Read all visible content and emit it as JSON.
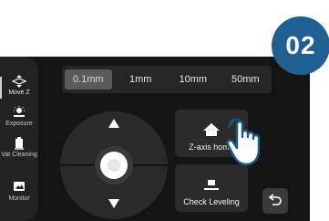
{
  "step_badge": "02",
  "sidebar": {
    "items": [
      {
        "label": "Move Z",
        "icon": "move-z-icon",
        "active": true
      },
      {
        "label": "Exposure",
        "icon": "exposure-icon"
      },
      {
        "label": "Vat Cleaning",
        "icon": "vat-cleaning-icon"
      },
      {
        "label": "Monitor",
        "icon": "monitor-icon"
      }
    ]
  },
  "step_options": {
    "items": [
      "0.1mm",
      "1mm",
      "10mm",
      "50mm"
    ],
    "selected": "0.1mm"
  },
  "joystick": {
    "up_icon": "triangle-up-icon",
    "down_icon": "triangle-down-icon",
    "center_icon": "center-dot-icon"
  },
  "buttons": {
    "z_axis_home": "Z-axis home",
    "check_leveling": "Check Leveling"
  },
  "back_icon": "back-arrow-icon",
  "pointer_icon": "tapping-hand-icon",
  "colors": {
    "badge": "#1f5f92",
    "screen_bg": "#141414",
    "panel_bg": "#2b2b2b",
    "selected_option": "#5a5a5a"
  }
}
